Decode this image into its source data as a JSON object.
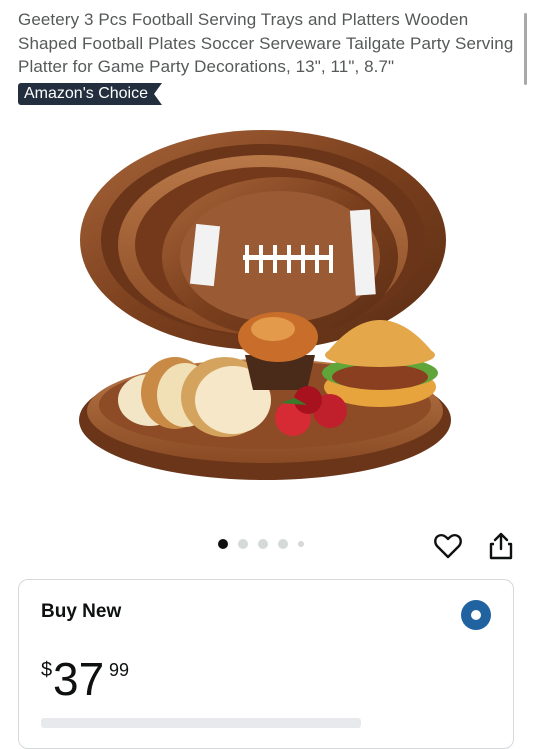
{
  "product": {
    "title": "Geetery 3 Pcs Football Serving Trays and Platters Wooden Shaped Football Plates Soccer Serveware Tailgate Party Serving Platter for Game Party Decorations, 13\", 11\", 8.7\"",
    "badge": "Amazon's Choice"
  },
  "gallery": {
    "image_count": 5,
    "active_index": 0
  },
  "icons": {
    "favorite": "heart-icon",
    "share": "share-icon"
  },
  "buy_box": {
    "title": "Buy New",
    "price_symbol": "$",
    "price_whole": "37",
    "price_fraction": "99",
    "selected": true
  },
  "colors": {
    "badge_bg": "#232f3e",
    "radio_selected": "#2162a1",
    "title_text": "#565959"
  }
}
